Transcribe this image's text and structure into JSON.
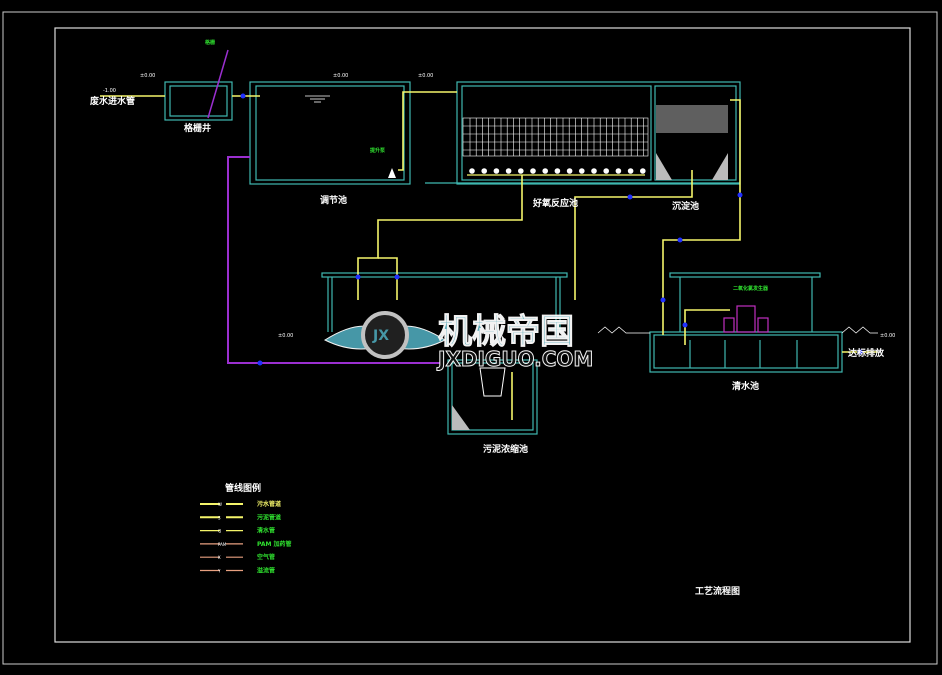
{
  "drawing": {
    "title": "工艺流程图",
    "units": {
      "inlet_pipe": "废水进水管",
      "screen_well": "格栅井",
      "equalization_tank": "调节池",
      "aerobic_tank": "好氧反应池",
      "sedimentation_tank": "沉淀池",
      "sludge_thickener": "污泥浓缩池",
      "clear_water_tank": "清水池",
      "discharge": "达标排放"
    },
    "annotations": {
      "screen": "格栅",
      "lift_pump": "提升泵",
      "elevation_1": "±0.00",
      "elevation_2": "±0.00",
      "elevation_3": "±0.00",
      "elevation_4": "±0.00",
      "elevation_5": "±0.00",
      "inlet_elev": "-1.00",
      "chlorine": "二氧化氯发生器"
    },
    "legend": {
      "title": "管线图例",
      "items": [
        {
          "code": "W",
          "label": "污水管道",
          "color": "#f5f56a"
        },
        {
          "code": "S",
          "label": "污泥管道",
          "color": "#f5f56a"
        },
        {
          "code": "Q",
          "label": "清水管",
          "color": "#f5f56a"
        },
        {
          "code": "PAM",
          "label": "PAM 加药管",
          "color": "#e8a080"
        },
        {
          "code": "K",
          "label": "空气管",
          "color": "#e8a080"
        },
        {
          "code": "Y",
          "label": "溢流管",
          "color": "#e8a080"
        }
      ]
    },
    "watermark": {
      "cn": "机械帝国",
      "en": "JXDIGUO.COM",
      "badge": "JX"
    },
    "colors": {
      "structure": "#3fb8b0",
      "pipe": "#f5f56a",
      "sludge": "#9b2fd0",
      "valve": "#2030ff",
      "label_green": "#2fe02f"
    }
  }
}
